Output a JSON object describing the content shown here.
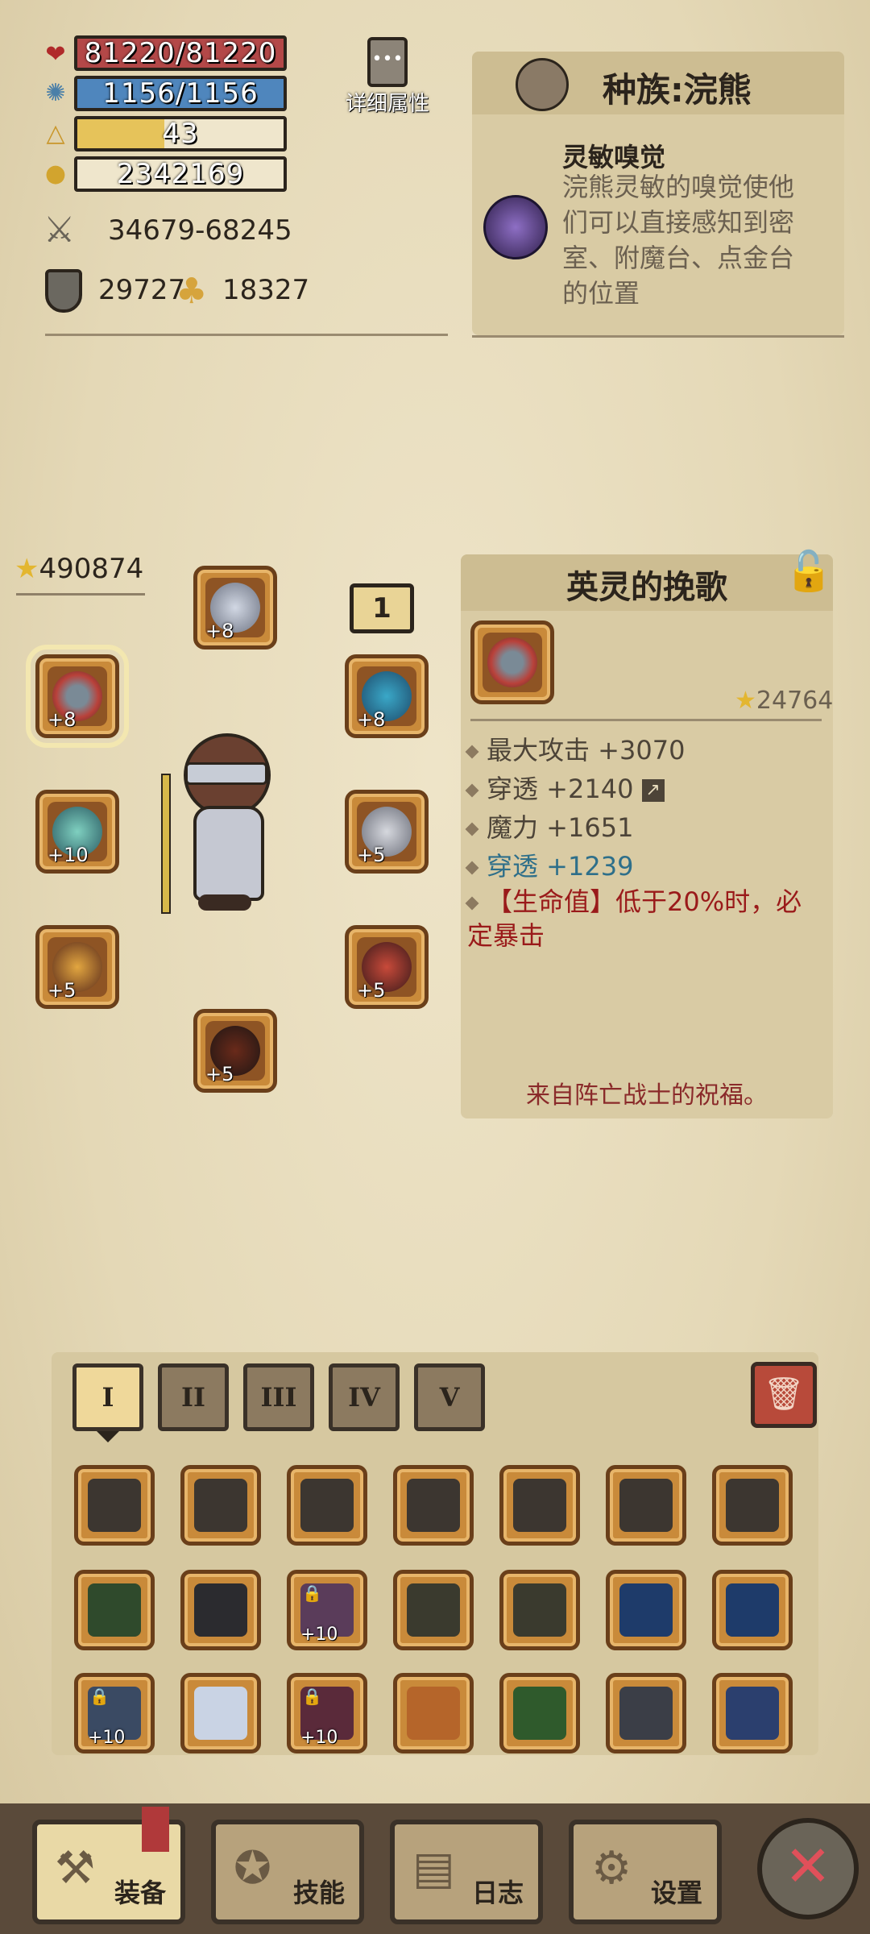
{
  "stats": {
    "hp": "81220/81220",
    "mana": "1156/1156",
    "level": "43",
    "gold": "2342169",
    "attack": "34679-68245",
    "defense": "29727",
    "luck": "18327"
  },
  "detail_button_label": "详细属性",
  "race": {
    "title": "种族:浣熊",
    "skill_name": "灵敏嗅觉",
    "skill_desc": "浣熊灵敏的嗅觉使他们可以直接感知到密室、附魔台、点金台的位置"
  },
  "power_score": "490874",
  "loadout_number": "1",
  "equipment_slots": [
    {
      "name": "crown",
      "level": "+8"
    },
    {
      "name": "ring",
      "level": "+8"
    },
    {
      "name": "necklace",
      "level": "+8"
    },
    {
      "name": "staff",
      "level": "+10"
    },
    {
      "name": "wings",
      "level": "+5"
    },
    {
      "name": "gloves",
      "level": "+5"
    },
    {
      "name": "armor",
      "level": "+5"
    },
    {
      "name": "boots",
      "level": "+5"
    }
  ],
  "item_detail": {
    "name": "英灵的挽歌",
    "score": "24764",
    "attrs": [
      {
        "text": "最大攻击 +3070",
        "color": "#4d4438"
      },
      {
        "text": "穿透 +2140",
        "color": "#4d4438"
      },
      {
        "text": "魔力 +1651",
        "color": "#4d4438"
      },
      {
        "text": "穿透 +1239",
        "color": "#2e6f8a"
      }
    ],
    "special": "【生命值】低于20%时，必定暴击",
    "flavor": "来自阵亡战士的祝福。"
  },
  "tabs": [
    "I",
    "II",
    "III",
    "IV",
    "V"
  ],
  "inventory": [
    [
      {
        "c": "#3c3630",
        "lvl": "",
        "lock": false
      },
      {
        "c": "#3c3630",
        "lvl": "",
        "lock": false
      },
      {
        "c": "#3c3630",
        "lvl": "",
        "lock": false
      },
      {
        "c": "#3c3630",
        "lvl": "",
        "lock": false
      },
      {
        "c": "#3c3630",
        "lvl": "",
        "lock": false
      },
      {
        "c": "#3c3630",
        "lvl": "",
        "lock": false
      },
      {
        "c": "#3c3630",
        "lvl": "",
        "lock": false
      }
    ],
    [
      {
        "c": "#2f4a2c",
        "lvl": "",
        "lock": false
      },
      {
        "c": "#2b2b2f",
        "lvl": "",
        "lock": false
      },
      {
        "c": "#5a3c5a",
        "lvl": "+10",
        "lock": true
      },
      {
        "c": "#3a3a2e",
        "lvl": "",
        "lock": false
      },
      {
        "c": "#3a3a2e",
        "lvl": "",
        "lock": false
      },
      {
        "c": "#1e3b6a",
        "lvl": "",
        "lock": false
      },
      {
        "c": "#1e3b6a",
        "lvl": "",
        "lock": false
      }
    ],
    [
      {
        "c": "#3a4a63",
        "lvl": "+10",
        "lock": true
      },
      {
        "c": "#c9d3e4",
        "lvl": "",
        "lock": false
      },
      {
        "c": "#5a2a3a",
        "lvl": "+10",
        "lock": true
      },
      {
        "c": "#b5652a",
        "lvl": "",
        "lock": false
      },
      {
        "c": "#2f5a2c",
        "lvl": "",
        "lock": false
      },
      {
        "c": "#3b3e47",
        "lvl": "",
        "lock": false
      },
      {
        "c": "#2b3f6e",
        "lvl": "",
        "lock": false
      }
    ]
  ],
  "nav": {
    "equip": "装备",
    "skills": "技能",
    "log": "日志",
    "settings": "设置"
  }
}
